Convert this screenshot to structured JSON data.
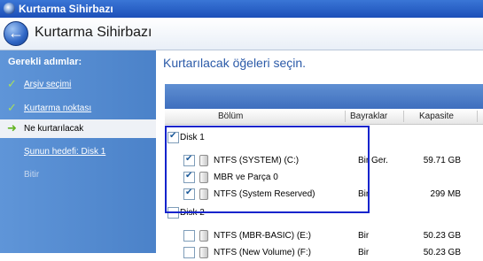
{
  "window": {
    "title": "Kurtarma Sihirbazı"
  },
  "header": {
    "title": "Kurtarma Sihirbazı"
  },
  "sidebar": {
    "heading": "Gerekli adımlar:",
    "items": [
      {
        "label": "Arşiv seçimi",
        "state": "done"
      },
      {
        "label": "Kurtarma noktası",
        "state": "done"
      },
      {
        "label": "Ne kurtarılacak",
        "state": "current"
      },
      {
        "label": "Şunun hedefi: Disk 1",
        "state": "link"
      },
      {
        "label": "Bitir",
        "state": "disabled"
      }
    ]
  },
  "main": {
    "title": "Kurtarılacak öğeleri seçin.",
    "columns": [
      "Bölüm",
      "Bayraklar",
      "Kapasite"
    ],
    "rows": [
      {
        "type": "group",
        "name": "Disk 1",
        "checked": true
      },
      {
        "type": "partition",
        "name": "NTFS (SYSTEM) (C:)",
        "flags": "Bir Ger.",
        "capacity": "59.71 GB",
        "checked": true
      },
      {
        "type": "partition",
        "name": "MBR ve Parça 0",
        "flags": "",
        "capacity": "",
        "checked": true
      },
      {
        "type": "partition",
        "name": "NTFS (System Reserved)",
        "flags": "Bir",
        "capacity": "299 MB",
        "checked": true
      },
      {
        "type": "group",
        "name": "Disk 2",
        "checked": false
      },
      {
        "type": "partition",
        "name": "NTFS (MBR-BASIC) (E:)",
        "flags": "Bir",
        "capacity": "50.23 GB",
        "checked": false
      },
      {
        "type": "partition",
        "name": "NTFS (New Volume) (F:)",
        "flags": "Bir",
        "capacity": "50.23 GB",
        "checked": false
      }
    ]
  },
  "colors": {
    "sidebar": "#5a90d4",
    "title_bar": "#2a62c8",
    "highlight": "#1424cc",
    "accent_text": "#2b5aa8"
  }
}
